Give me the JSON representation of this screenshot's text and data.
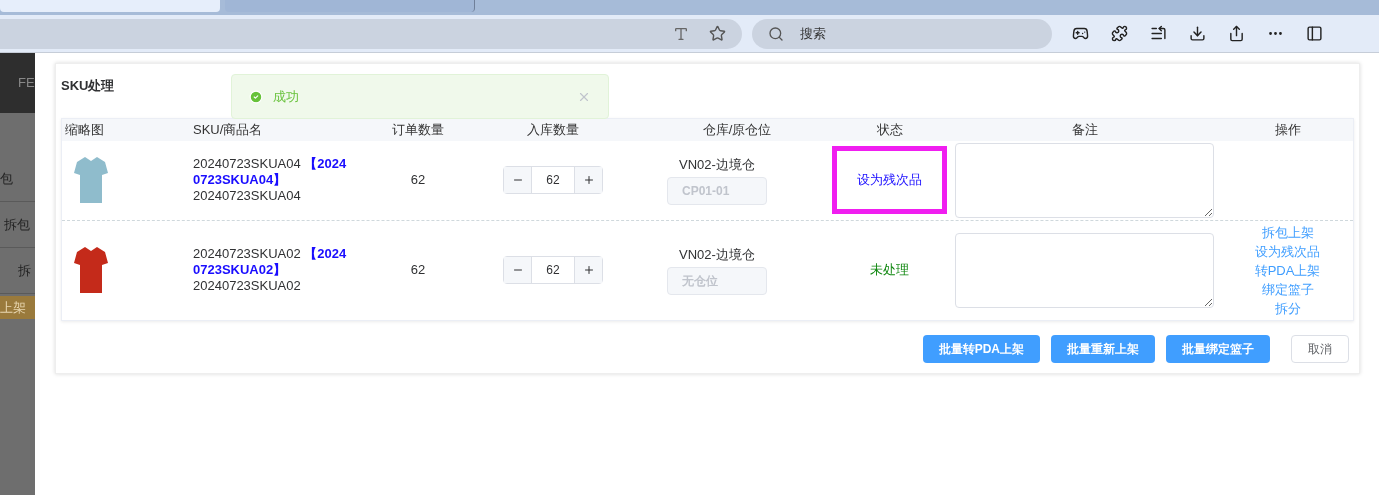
{
  "sidebar": {
    "header": "FE",
    "items": [
      {
        "label": "包"
      },
      {
        "label": "拆包"
      },
      {
        "label": "拆"
      }
    ],
    "highlight": "上架"
  },
  "search": {
    "placeholder": "搜索"
  },
  "dialog": {
    "title": "SKU处理",
    "toast": {
      "kind": "success",
      "message": "成功"
    },
    "table": {
      "columns": [
        "缩略图",
        "SKU/商品名",
        "订单数量",
        "入库数量",
        "仓库/原仓位",
        "状态",
        "备注",
        "操作"
      ],
      "rows": [
        {
          "color": "#8fbccc",
          "sku": "20240723SKUA04",
          "code": "【20240723SKUA04】",
          "name": "20240723SKUA04",
          "order_qty": "62",
          "inbound_qty": "62",
          "warehouse": "VN02-边境仓",
          "location": {
            "value": "CP01-01",
            "disabled": true
          },
          "status": {
            "kind": "defective",
            "label": "设为残次品",
            "highlighted": true
          },
          "remark": "",
          "actions": []
        },
        {
          "color": "#c42a1a",
          "sku": "20240723SKUA02",
          "code": "【20240723SKUA02】",
          "name": "20240723SKUA02",
          "order_qty": "62",
          "inbound_qty": "62",
          "warehouse": "VN02-边境仓",
          "location": {
            "placeholder": "无仓位",
            "disabled": true
          },
          "status": {
            "kind": "pending",
            "label": "未处理",
            "highlighted": false
          },
          "actions": [
            "拆包上架",
            "设为残次品",
            "转PDA上架",
            "绑定篮子",
            "拆分"
          ]
        }
      ]
    },
    "buttons": [
      {
        "kind": "primary",
        "label": "批量转PDA上架"
      },
      {
        "kind": "primary",
        "label": "批量重新上架"
      },
      {
        "kind": "primary",
        "label": "批量绑定篮子"
      },
      {
        "kind": "default",
        "label": "取消"
      }
    ]
  }
}
